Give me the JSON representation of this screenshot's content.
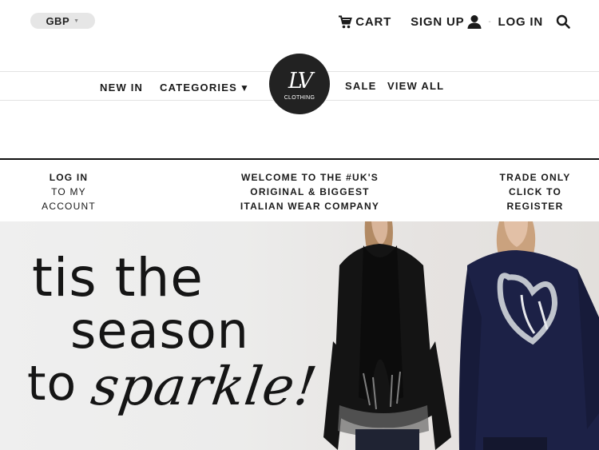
{
  "header": {
    "currency": "GBP",
    "cart_label": "CART",
    "signup_label": "SIGN UP",
    "separator": "-",
    "login_label": "LOG IN"
  },
  "nav": {
    "new_in": "NEW IN",
    "categories": "CATEGORIES",
    "sale": "SALE",
    "view_all": "VIEW ALL"
  },
  "logo": {
    "monogram": "LV",
    "subtitle": "CLOTHING"
  },
  "promo": {
    "login": {
      "line1": "LOG IN",
      "line2": "TO MY",
      "line3": "ACCOUNT"
    },
    "welcome": {
      "line1": "WELCOME TO THE #UK'S",
      "line2": "ORIGINAL & BIGGEST",
      "line3": "ITALIAN WEAR COMPANY"
    },
    "trade": {
      "line1": "TRADE ONLY",
      "line2": "CLICK TO",
      "line3": "REGISTER"
    }
  },
  "hero": {
    "line1": "tis the",
    "line2": "season",
    "line3": "to",
    "line4": "sparkle!"
  },
  "colors": {
    "text": "#1a1a1a",
    "logo_bg": "#222222",
    "hero_bg": "#ececeb",
    "navy_sweater": "#1c2146",
    "black_sweater": "#141414"
  },
  "icons": [
    "cart-icon",
    "user-icon",
    "search-icon",
    "chevron-down-icon"
  ]
}
